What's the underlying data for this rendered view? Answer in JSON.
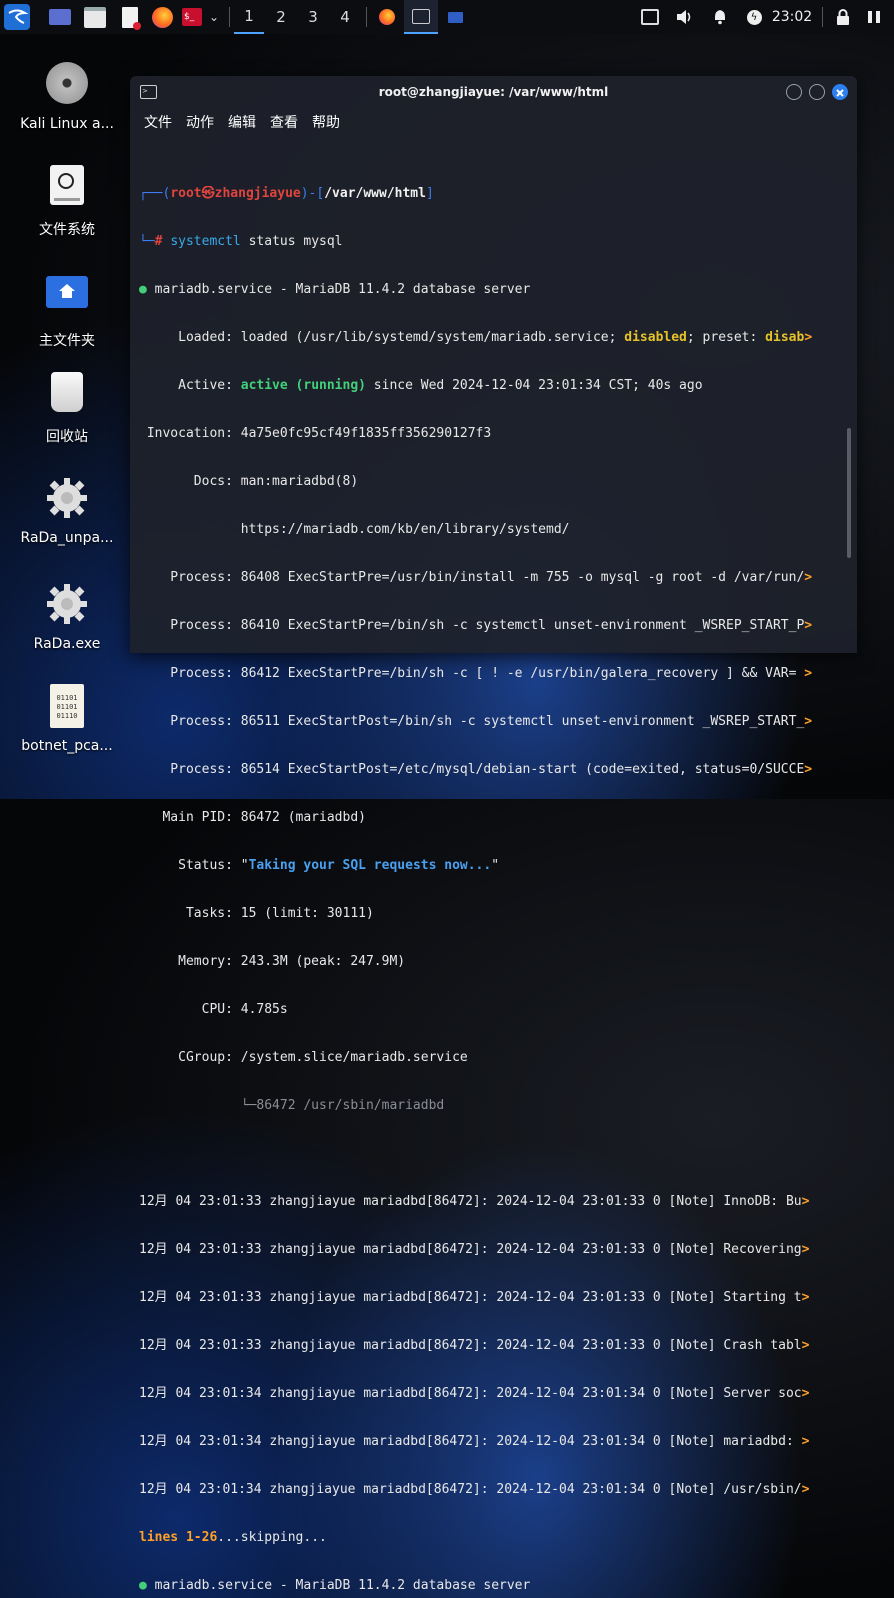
{
  "taskbar": {
    "workspaces": [
      "1",
      "2",
      "3",
      "4"
    ],
    "clock": "23:02"
  },
  "desktop_icons": [
    {
      "label": "Kali Linux a...",
      "icon": "disc-icon"
    },
    {
      "label": "文件系统",
      "icon": "drive-icon"
    },
    {
      "label": "主文件夹",
      "icon": "home-folder-icon"
    },
    {
      "label": "回收站",
      "icon": "trash-icon"
    },
    {
      "label": "RaDa_unpa...",
      "icon": "gear-file-icon"
    },
    {
      "label": "RaDa.exe",
      "icon": "gear-file-icon"
    },
    {
      "label": "botnet_pca...",
      "icon": "binary-file-icon"
    }
  ],
  "terminal": {
    "title": "root@zhangjiayue: /var/www/html",
    "menu": [
      "文件",
      "动作",
      "编辑",
      "查看",
      "帮助"
    ],
    "prompt": {
      "user": "root",
      "at": "㉿",
      "host": "zhangjiayue",
      "path": "/var/www/html",
      "symbol": "#",
      "command": "systemctl",
      "args": " status mysql"
    },
    "lines": {
      "service": "● mariadb.service - MariaDB 11.4.2 database server",
      "loaded_pre": "     Loaded: loaded (/usr/lib/systemd/system/mariadb.service; ",
      "loaded_dis": "disabled",
      "loaded_mid": "; preset: ",
      "loaded_end": "disab",
      "active_pre": "     Active: ",
      "active_val": "active (running)",
      "active_post": " since Wed 2024-12-04 23:01:34 CST; 40s ago",
      "invocation": " Invocation: 4a75e0fc95cf49f1835ff356290127f3",
      "docs1": "       Docs: man:mariadbd(8)",
      "docs2": "             https://mariadb.com/kb/en/library/systemd/",
      "proc": [
        "    Process: 86408 ExecStartPre=/usr/bin/install -m 755 -o mysql -g root -d /var/run/",
        "    Process: 86410 ExecStartPre=/bin/sh -c systemctl unset-environment _WSREP_START_P",
        "    Process: 86412 ExecStartPre=/bin/sh -c [ ! -e /usr/bin/galera_recovery ] && VAR= ",
        "    Process: 86511 ExecStartPost=/bin/sh -c systemctl unset-environment _WSREP_START_",
        "    Process: 86514 ExecStartPost=/etc/mysql/debian-start (code=exited, status=0/SUCCE"
      ],
      "mainpid": "   Main PID: 86472 (mariadbd)",
      "status_pre": "     Status: \"",
      "status_val": "Taking your SQL requests now...",
      "status_post": "\"",
      "tasks": "      Tasks: 15 (limit: 30111)",
      "memory": "     Memory: 243.3M (peak: 247.9M)",
      "cpu": "        CPU: 4.785s",
      "cgroup": "     CGroup: /system.slice/mariadb.service",
      "cgroup_child": "             └─86472 /usr/sbin/mariadbd",
      "logs": [
        "12月 04 23:01:33 zhangjiayue mariadbd[86472]: 2024-12-04 23:01:33 0 [Note] InnoDB: Bu",
        "12月 04 23:01:33 zhangjiayue mariadbd[86472]: 2024-12-04 23:01:33 0 [Note] Recovering",
        "12月 04 23:01:33 zhangjiayue mariadbd[86472]: 2024-12-04 23:01:33 0 [Note] Starting t",
        "12月 04 23:01:33 zhangjiayue mariadbd[86472]: 2024-12-04 23:01:33 0 [Note] Crash tabl",
        "12月 04 23:01:34 zhangjiayue mariadbd[86472]: 2024-12-04 23:01:34 0 [Note] Server soc",
        "12月 04 23:01:34 zhangjiayue mariadbd[86472]: 2024-12-04 23:01:34 0 [Note] mariadbd: ",
        "12月 04 23:01:34 zhangjiayue mariadbd[86472]: 2024-12-04 23:01:34 0 [Note] /usr/sbin/"
      ],
      "truncation_marker": ">",
      "pager": "lines 1-26",
      "pager_skip": "...skipping...",
      "service2": "● mariadb.service - MariaDB 11.4.2 database server"
    }
  }
}
